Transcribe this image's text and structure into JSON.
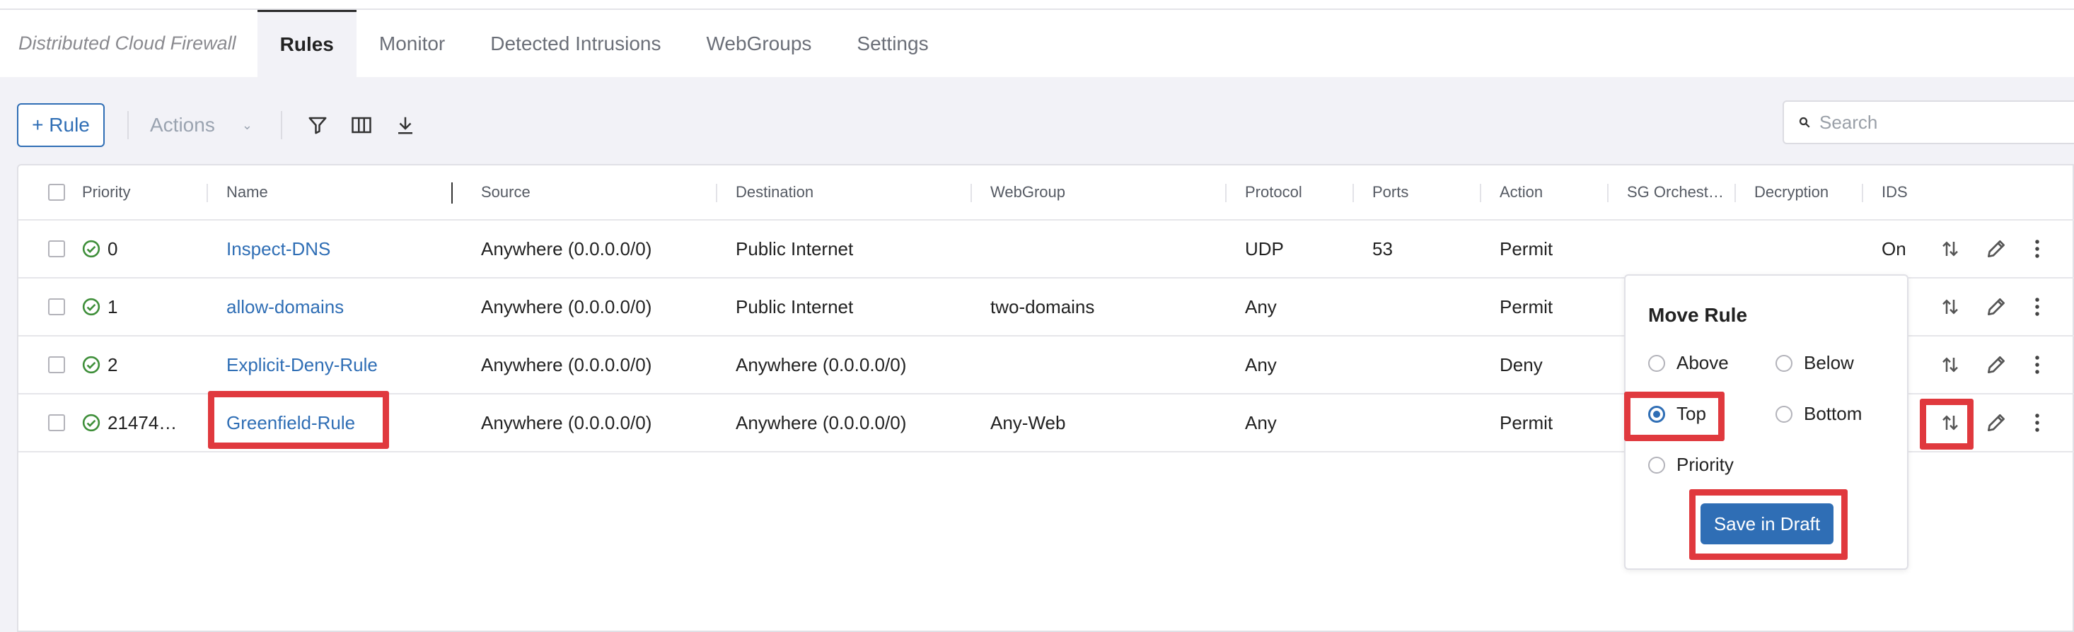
{
  "nav": {
    "brand": "Distributed Cloud Firewall",
    "tabs": [
      {
        "label": "Rules",
        "active": true
      },
      {
        "label": "Monitor",
        "active": false
      },
      {
        "label": "Detected Intrusions",
        "active": false
      },
      {
        "label": "WebGroups",
        "active": false
      },
      {
        "label": "Settings",
        "active": false
      }
    ]
  },
  "toolbar": {
    "add_rule_label": "+ Rule",
    "actions_label": "Actions",
    "icons": [
      "filter-icon",
      "columns-icon",
      "download-icon"
    ],
    "search_placeholder": "Search"
  },
  "table": {
    "headers": [
      "Priority",
      "Name",
      "Source",
      "Destination",
      "WebGroup",
      "Protocol",
      "Ports",
      "Action",
      "SG Orchest…",
      "Decryption",
      "IDS"
    ],
    "rows": [
      {
        "priority": "0",
        "name": "Inspect-DNS",
        "source": "Anywhere (0.0.0.0/0)",
        "destination": "Public Internet",
        "webgroup": "",
        "protocol": "UDP",
        "ports": "53",
        "action": "Permit",
        "ids": "On"
      },
      {
        "priority": "1",
        "name": "allow-domains",
        "source": "Anywhere (0.0.0.0/0)",
        "destination": "Public Internet",
        "webgroup": "two-domains",
        "protocol": "Any",
        "ports": "",
        "action": "Permit",
        "ids": ""
      },
      {
        "priority": "2",
        "name": "Explicit-Deny-Rule",
        "source": "Anywhere (0.0.0.0/0)",
        "destination": "Anywhere (0.0.0.0/0)",
        "webgroup": "",
        "protocol": "Any",
        "ports": "",
        "action": "Deny",
        "ids": ""
      },
      {
        "priority": "21474…",
        "name": "Greenfield-Rule",
        "source": "Anywhere (0.0.0.0/0)",
        "destination": "Anywhere (0.0.0.0/0)",
        "webgroup": "Any-Web",
        "protocol": "Any",
        "ports": "",
        "action": "Permit",
        "ids": ""
      }
    ]
  },
  "move_rule": {
    "title": "Move Rule",
    "options": [
      {
        "label": "Above",
        "checked": false
      },
      {
        "label": "Below",
        "checked": false
      },
      {
        "label": "Top",
        "checked": true
      },
      {
        "label": "Bottom",
        "checked": false
      },
      {
        "label": "Priority",
        "checked": false
      }
    ],
    "save_label": "Save in Draft"
  },
  "colors": {
    "accent": "#2f6eb5",
    "highlight": "#e0393e",
    "status_ok": "#3f8f3a"
  }
}
